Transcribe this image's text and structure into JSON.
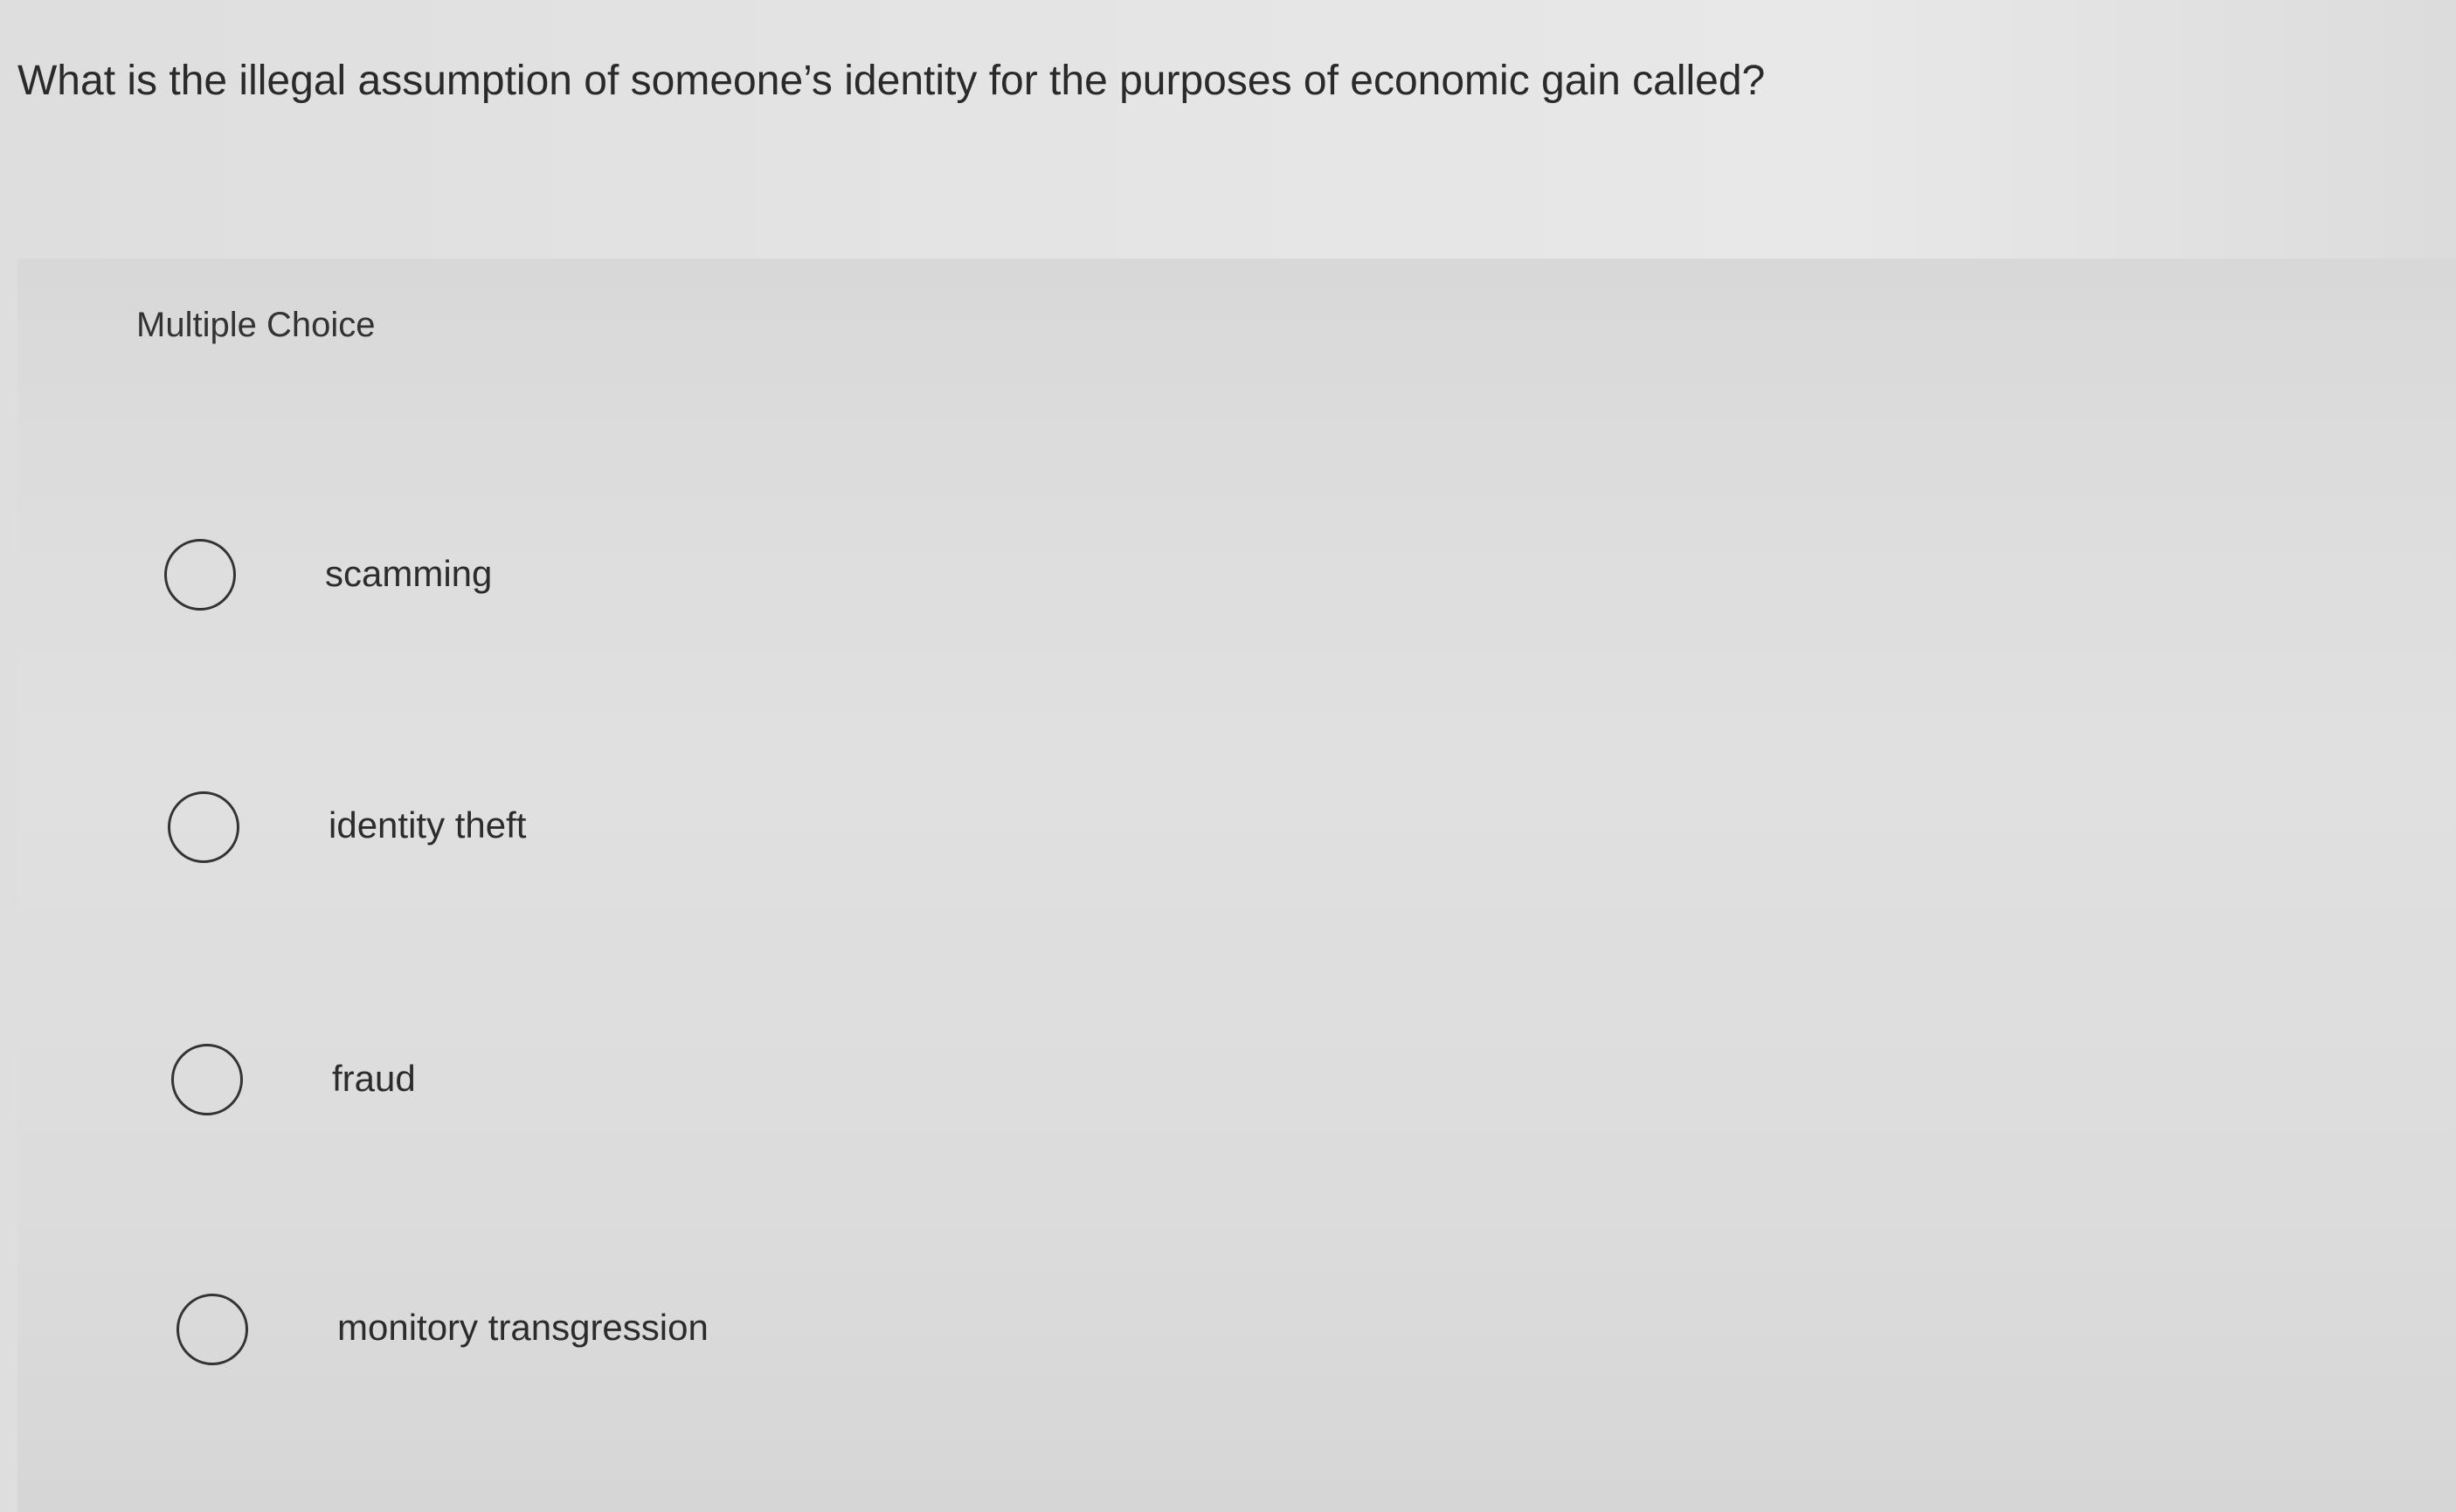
{
  "question": {
    "text": "What is the illegal assumption of someone’s identity for the purposes of economic gain called?"
  },
  "multiple_choice": {
    "label": "Multiple Choice",
    "options": [
      {
        "text": "scamming",
        "selected": false
      },
      {
        "text": "identity theft",
        "selected": false
      },
      {
        "text": "fraud",
        "selected": false
      },
      {
        "text": "monitory transgression",
        "selected": false
      }
    ]
  },
  "colors": {
    "background": "#e2e2e2",
    "panel": "#dcdcdc",
    "text": "#2b2b2b",
    "radio_border": "#333333"
  }
}
